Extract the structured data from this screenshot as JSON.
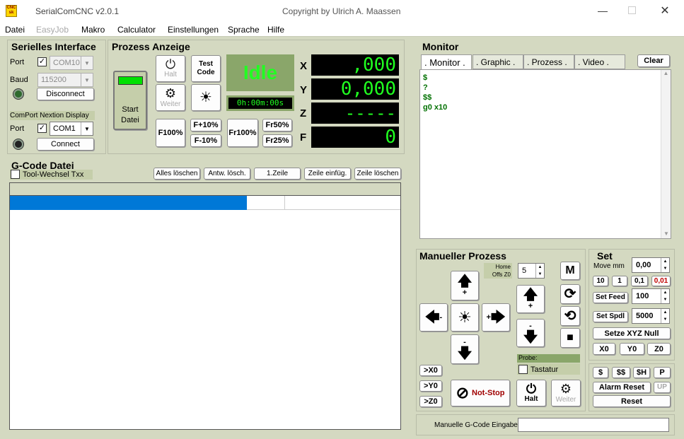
{
  "window": {
    "title": "SerialComCNC  v2.0.1",
    "copyright": "Copyright by Ulrich A. Maassen",
    "icon_text": "CNC\nsk"
  },
  "menu": [
    "Datei",
    "EasyJob",
    "Makro",
    "Calculator",
    "Einstellungen",
    "Sprache",
    "Hilfe"
  ],
  "serial": {
    "title": "Serielles Interface",
    "port_label": "Port",
    "port_value": "COM10",
    "baud_label": "Baud",
    "baud_value": "115200",
    "disconnect": "Disconnect",
    "nextion_label": "ComPort Nextion Display",
    "port2_label": "Port",
    "port2_value": "COM1",
    "connect": "Connect"
  },
  "prozess": {
    "title": "Prozess Anzeige",
    "start_line1": "Start",
    "start_line2": "Datei",
    "halt": "Halt",
    "test_code": "Test\nCode",
    "weiter": "Weiter",
    "status": "Idle",
    "timer": "0h:00m:00s",
    "f100": "F100%",
    "fplus10": "F+10%",
    "fminus10": "F-10%",
    "fr100": "Fr100%",
    "fr50": "Fr50%",
    "fr25": "Fr25%"
  },
  "axes": [
    {
      "name": "X",
      "value": ",000"
    },
    {
      "name": "Y",
      "value": "0,000"
    },
    {
      "name": "Z",
      "value": "-----"
    },
    {
      "name": "F",
      "value": "0"
    }
  ],
  "gcode": {
    "title": "G-Code Datei",
    "tool_change": "Tool-Wechsel Txx",
    "buttons": [
      "Alles löschen",
      "Antw. lösch.",
      "1.Zeile",
      "Zeile einfüg.",
      "Zeile löschen"
    ]
  },
  "monitor": {
    "title": "Monitor",
    "tabs": [
      ". Monitor .",
      ". Graphic .",
      ". Prozess .",
      ". Video ."
    ],
    "clear": "Clear",
    "lines": [
      "$",
      "?",
      "$$",
      "g0 x10"
    ]
  },
  "manual": {
    "title": "Manueller Prozess",
    "home": "Home",
    "offs": "Offs Z0",
    "step_value": "5",
    "m_button": "M",
    "probe_label": "Probe:",
    "keyboard": "Tastatur",
    "x0": ">X0",
    "y0": ">Y0",
    "z0": ">Z0",
    "not_stop": "Not-Stop",
    "halt": "Halt",
    "weiter": "Weiter",
    "gcode_input_label": "Manuelle G-Code Eingabe",
    "plus": "+",
    "minus": "-"
  },
  "set": {
    "title": "Set",
    "move_mm": "Move mm",
    "move_value": "0,00",
    "steps": [
      "10",
      "1",
      "0,1",
      "0,01"
    ],
    "set_feed": "Set Feed",
    "feed_value": "100",
    "set_spdl": "Set Spdl",
    "spdl_value": "5000",
    "setze_xyz": "Setze XYZ Null",
    "x0": "X0",
    "y0": "Y0",
    "z0": "Z0",
    "cmds": [
      "$",
      "$$",
      "$H",
      "P"
    ],
    "alarm_reset": "Alarm Reset",
    "up": "UP",
    "reset": "Reset"
  },
  "colors": {
    "panel": "#d4d9c1",
    "lcd_text": "#20ff20",
    "idle_bg": "#8aa66a",
    "idle_text": "#22ff22",
    "selection": "#0078d7",
    "monitor_text": "#007000",
    "alarm_red": "#c00000"
  }
}
